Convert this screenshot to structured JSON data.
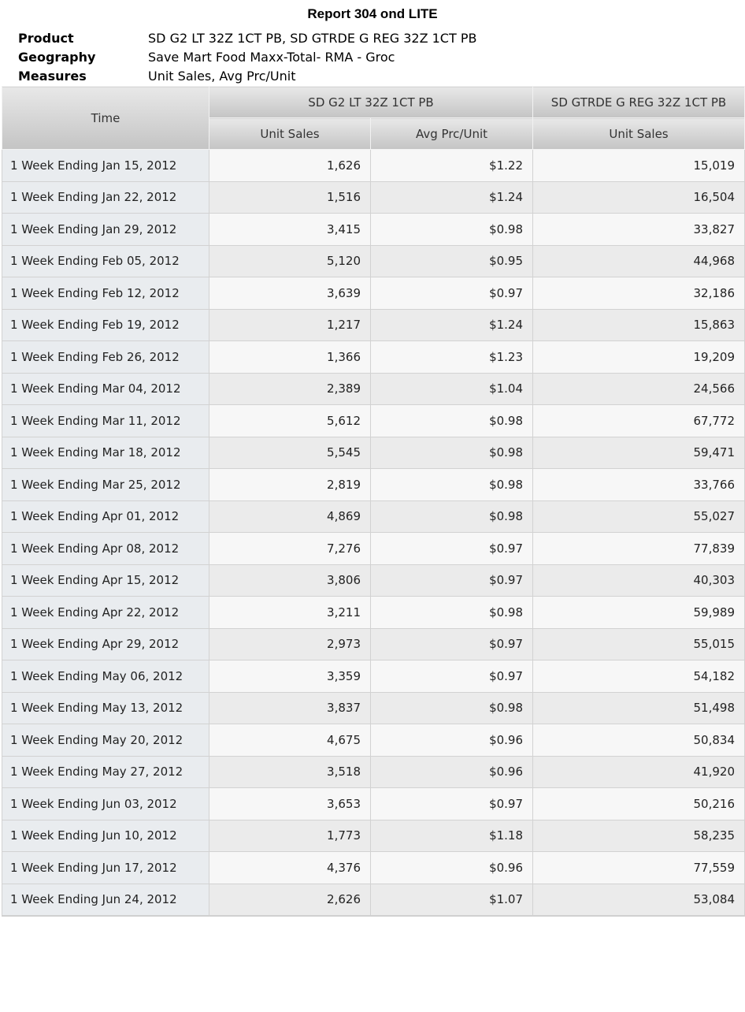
{
  "title": "Report 304 ond LITE",
  "meta": [
    {
      "label": "Product",
      "value": "SD G2 LT 32Z 1CT PB, SD GTRDE G REG 32Z 1CT PB"
    },
    {
      "label": "Geography",
      "value": "Save Mart Food Maxx-Total- RMA - Groc"
    },
    {
      "label": "Measures",
      "value": "Unit Sales, Avg Prc/Unit"
    }
  ],
  "table": {
    "time_header": "Time",
    "product_headers": [
      "SD G2 LT 32Z 1CT PB",
      "SD GTRDE G REG 32Z 1CT PB"
    ],
    "measure_headers": [
      "Unit Sales",
      "Avg Prc/Unit",
      "Unit Sales"
    ],
    "rows": [
      {
        "time": "1 Week Ending Jan 15, 2012",
        "g2_units": "1,626",
        "g2_price": "$1.22",
        "gtrde_units": "15,019"
      },
      {
        "time": "1 Week Ending Jan 22, 2012",
        "g2_units": "1,516",
        "g2_price": "$1.24",
        "gtrde_units": "16,504"
      },
      {
        "time": "1 Week Ending Jan 29, 2012",
        "g2_units": "3,415",
        "g2_price": "$0.98",
        "gtrde_units": "33,827"
      },
      {
        "time": "1 Week Ending Feb 05, 2012",
        "g2_units": "5,120",
        "g2_price": "$0.95",
        "gtrde_units": "44,968"
      },
      {
        "time": "1 Week Ending Feb 12, 2012",
        "g2_units": "3,639",
        "g2_price": "$0.97",
        "gtrde_units": "32,186"
      },
      {
        "time": "1 Week Ending Feb 19, 2012",
        "g2_units": "1,217",
        "g2_price": "$1.24",
        "gtrde_units": "15,863"
      },
      {
        "time": "1 Week Ending Feb 26, 2012",
        "g2_units": "1,366",
        "g2_price": "$1.23",
        "gtrde_units": "19,209"
      },
      {
        "time": "1 Week Ending Mar 04, 2012",
        "g2_units": "2,389",
        "g2_price": "$1.04",
        "gtrde_units": "24,566"
      },
      {
        "time": "1 Week Ending Mar 11, 2012",
        "g2_units": "5,612",
        "g2_price": "$0.98",
        "gtrde_units": "67,772"
      },
      {
        "time": "1 Week Ending Mar 18, 2012",
        "g2_units": "5,545",
        "g2_price": "$0.98",
        "gtrde_units": "59,471"
      },
      {
        "time": "1 Week Ending Mar 25, 2012",
        "g2_units": "2,819",
        "g2_price": "$0.98",
        "gtrde_units": "33,766"
      },
      {
        "time": "1 Week Ending Apr 01, 2012",
        "g2_units": "4,869",
        "g2_price": "$0.98",
        "gtrde_units": "55,027"
      },
      {
        "time": "1 Week Ending Apr 08, 2012",
        "g2_units": "7,276",
        "g2_price": "$0.97",
        "gtrde_units": "77,839"
      },
      {
        "time": "1 Week Ending Apr 15, 2012",
        "g2_units": "3,806",
        "g2_price": "$0.97",
        "gtrde_units": "40,303"
      },
      {
        "time": "1 Week Ending Apr 22, 2012",
        "g2_units": "3,211",
        "g2_price": "$0.98",
        "gtrde_units": "59,989"
      },
      {
        "time": "1 Week Ending Apr 29, 2012",
        "g2_units": "2,973",
        "g2_price": "$0.97",
        "gtrde_units": "55,015"
      },
      {
        "time": "1 Week Ending May 06, 2012",
        "g2_units": "3,359",
        "g2_price": "$0.97",
        "gtrde_units": "54,182"
      },
      {
        "time": "1 Week Ending May 13, 2012",
        "g2_units": "3,837",
        "g2_price": "$0.98",
        "gtrde_units": "51,498"
      },
      {
        "time": "1 Week Ending May 20, 2012",
        "g2_units": "4,675",
        "g2_price": "$0.96",
        "gtrde_units": "50,834"
      },
      {
        "time": "1 Week Ending May 27, 2012",
        "g2_units": "3,518",
        "g2_price": "$0.96",
        "gtrde_units": "41,920"
      },
      {
        "time": "1 Week Ending Jun 03, 2012",
        "g2_units": "3,653",
        "g2_price": "$0.97",
        "gtrde_units": "50,216"
      },
      {
        "time": "1 Week Ending Jun 10, 2012",
        "g2_units": "1,773",
        "g2_price": "$1.18",
        "gtrde_units": "58,235"
      },
      {
        "time": "1 Week Ending Jun 17, 2012",
        "g2_units": "4,376",
        "g2_price": "$0.96",
        "gtrde_units": "77,559"
      },
      {
        "time": "1 Week Ending Jun 24, 2012",
        "g2_units": "2,626",
        "g2_price": "$1.07",
        "gtrde_units": "53,084"
      }
    ]
  }
}
